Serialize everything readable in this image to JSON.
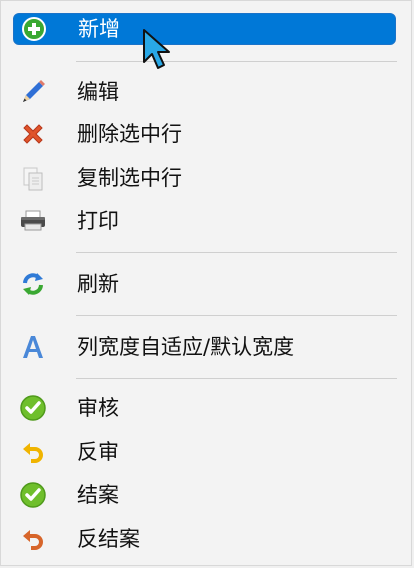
{
  "menu": {
    "items": [
      {
        "id": "add",
        "label": "新增",
        "icon": "plus-circle-icon",
        "selected": true
      },
      {
        "id": "edit",
        "label": "编辑",
        "icon": "pencil-icon"
      },
      {
        "id": "delete",
        "label": "删除选中行",
        "icon": "red-x-icon"
      },
      {
        "id": "copy",
        "label": "复制选中行",
        "icon": "copy-document-icon"
      },
      {
        "id": "print",
        "label": "打印",
        "icon": "printer-icon"
      },
      {
        "id": "refresh",
        "label": "刷新",
        "icon": "refresh-icon"
      },
      {
        "id": "autofit",
        "label": "列宽度自适应/默认宽度",
        "icon": "letter-a-icon"
      },
      {
        "id": "audit",
        "label": "审核",
        "icon": "green-check-icon"
      },
      {
        "id": "unaudit",
        "label": "反审",
        "icon": "undo-arrow-icon"
      },
      {
        "id": "settle",
        "label": "结案",
        "icon": "green-check-icon"
      },
      {
        "id": "unsettle",
        "label": "反结案",
        "icon": "undo-arrow-icon"
      }
    ]
  },
  "colors": {
    "selected_bg": "#0078d7",
    "menu_bg": "#f3f3f3",
    "separator": "#cfcfcf"
  }
}
